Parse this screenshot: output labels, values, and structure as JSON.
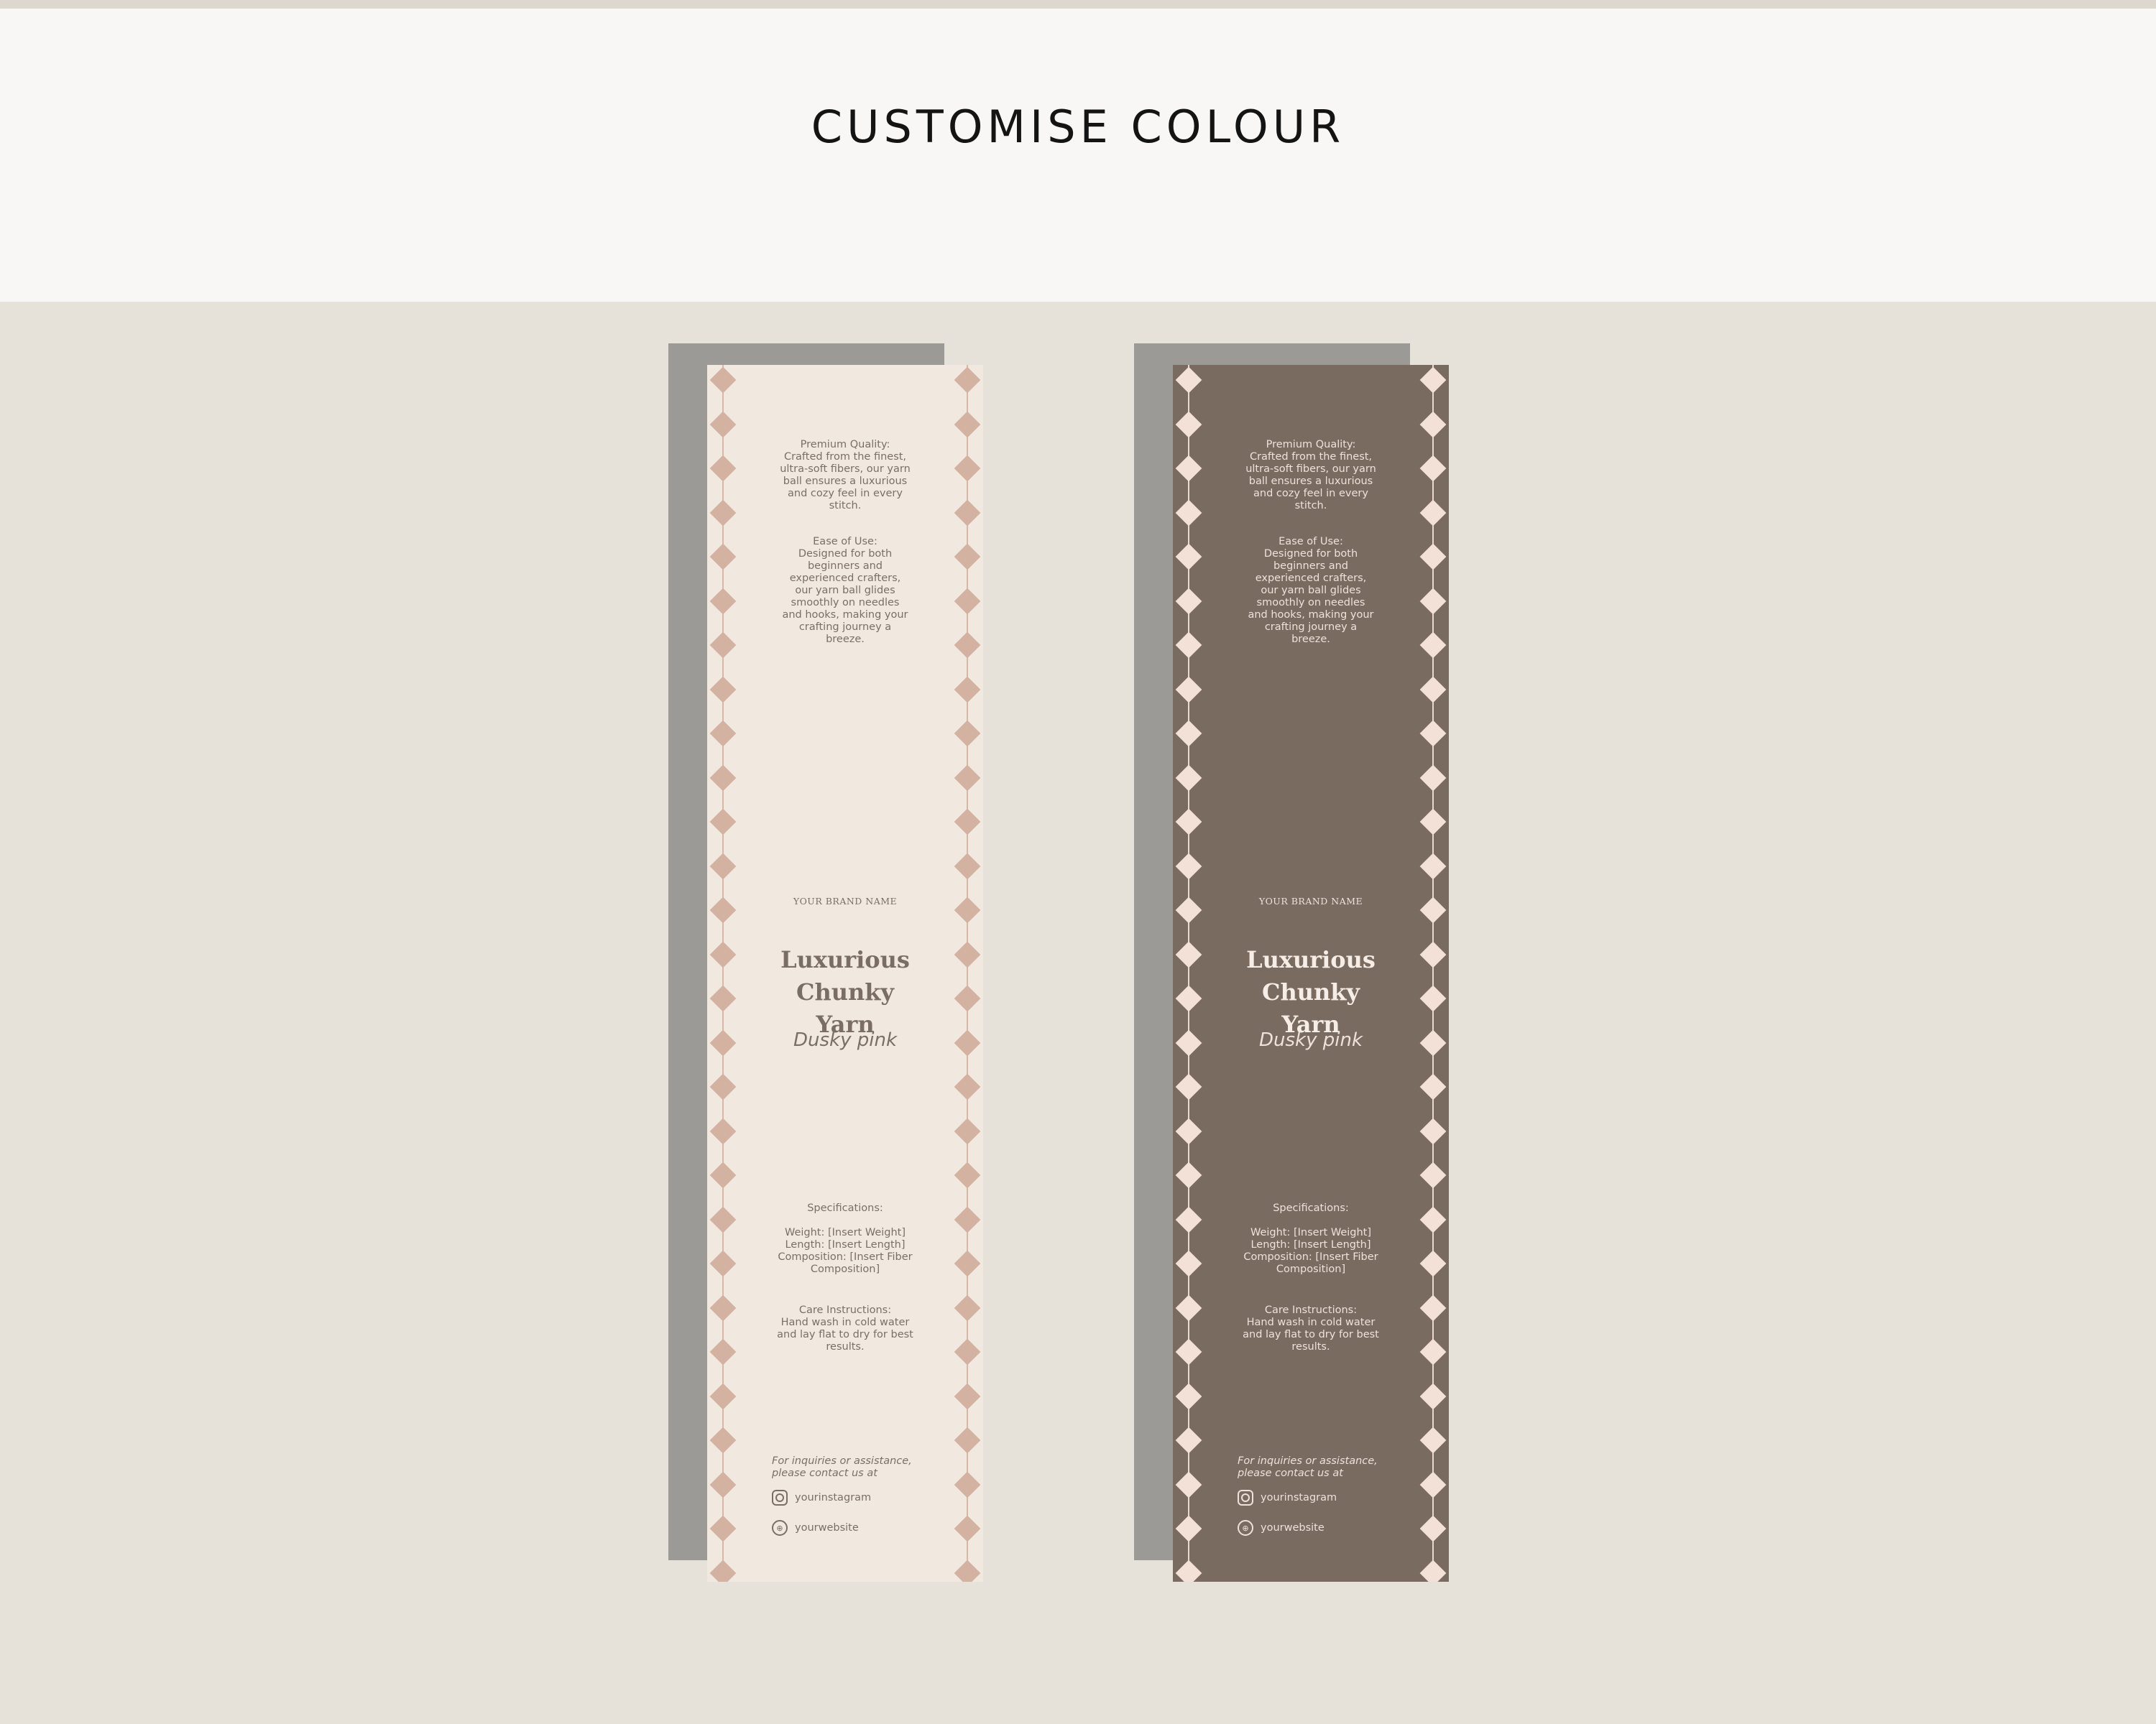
{
  "header": {
    "title": "CUSTOMISE COLOUR"
  },
  "colors": {
    "light_card": "#f1e9e0",
    "dark_card": "#7a6b60",
    "accent_pink": "#d3b2a2",
    "shadow": "#9c9a96"
  },
  "cards": [
    {
      "variant": "light",
      "premium_title": "Premium Quality:",
      "premium_lines": [
        "Crafted from the finest,",
        "ultra-soft fibers, our yarn",
        "ball ensures a luxurious",
        "and cozy feel in every",
        "stitch."
      ],
      "ease_title": "Ease of Use:",
      "ease_lines": [
        "Designed for both",
        "beginners and",
        "experienced crafters,",
        "our yarn ball glides",
        "smoothly on needles",
        "and hooks, making your",
        "crafting journey a",
        "breeze."
      ],
      "brand": "YOUR BRAND NAME",
      "title_line1": "Luxurious",
      "title_line2": "Chunky Yarn",
      "subtitle": "Dusky pink",
      "spec_title": "Specifications:",
      "spec_lines": [
        "Weight: [Insert Weight]",
        "Length: [Insert Length]",
        "Composition: [Insert Fiber",
        "Composition]"
      ],
      "care_title": "Care Instructions:",
      "care_lines": [
        "Hand wash in cold water",
        "and lay flat to dry for best",
        "results."
      ],
      "contact_lines": [
        "For inquiries or assistance,",
        "please contact us at"
      ],
      "instagram": "yourinstagram",
      "website": "yourwebsite"
    },
    {
      "variant": "dark",
      "premium_title": "Premium Quality:",
      "premium_lines": [
        "Crafted from the finest,",
        "ultra-soft fibers, our yarn",
        "ball ensures a luxurious",
        "and cozy feel in every",
        "stitch."
      ],
      "ease_title": "Ease of Use:",
      "ease_lines": [
        "Designed for both",
        "beginners and",
        "experienced crafters,",
        "our yarn ball glides",
        "smoothly on needles",
        "and hooks, making your",
        "crafting journey a",
        "breeze."
      ],
      "brand": "YOUR BRAND NAME",
      "title_line1": "Luxurious",
      "title_line2": "Chunky Yarn",
      "subtitle": "Dusky pink",
      "spec_title": "Specifications:",
      "spec_lines": [
        "Weight: [Insert Weight]",
        "Length: [Insert Length]",
        "Composition: [Insert Fiber",
        "Composition]"
      ],
      "care_title": "Care Instructions:",
      "care_lines": [
        "Hand wash in cold water",
        "and lay flat to dry for best",
        "results."
      ],
      "contact_lines": [
        "For inquiries or assistance,",
        "please contact us at"
      ],
      "instagram": "yourinstagram",
      "website": "yourwebsite"
    }
  ]
}
